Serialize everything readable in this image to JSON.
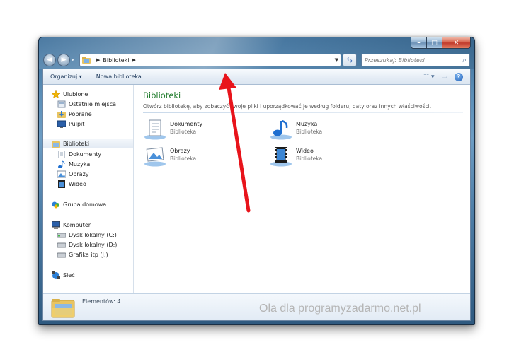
{
  "window": {
    "caption_buttons": {
      "minimize": "–",
      "maximize": "□",
      "close": "✕"
    }
  },
  "nav": {
    "back_glyph": "◀",
    "forward_glyph": "▶",
    "address": {
      "path_label": "Biblioteki"
    },
    "search_placeholder": "Przeszukaj: Biblioteki"
  },
  "toolbar": {
    "organize_label": "Organizuj ▾",
    "new_library_label": "Nowa biblioteka"
  },
  "sidebar": {
    "items": [
      {
        "label": "Ulubione",
        "icon": "star-icon"
      },
      {
        "label": "Ostatnie miejsca",
        "icon": "recent-places-icon"
      },
      {
        "label": "Pobrane",
        "icon": "downloads-icon"
      },
      {
        "label": "Pulpit",
        "icon": "desktop-icon"
      },
      {
        "label": "Biblioteki",
        "icon": "libraries-icon"
      },
      {
        "label": "Dokumenty",
        "icon": "documents-icon"
      },
      {
        "label": "Muzyka",
        "icon": "music-icon"
      },
      {
        "label": "Obrazy",
        "icon": "pictures-icon"
      },
      {
        "label": "Wideo",
        "icon": "video-icon"
      },
      {
        "label": "Grupa domowa",
        "icon": "homegroup-icon"
      },
      {
        "label": "Komputer",
        "icon": "computer-icon"
      },
      {
        "label": "Dysk lokalny (C:)",
        "icon": "drive-icon"
      },
      {
        "label": "Dysk lokalny (D:)",
        "icon": "drive-icon"
      },
      {
        "label": "Grafika itp (J:)",
        "icon": "drive-icon"
      },
      {
        "label": "Sieć",
        "icon": "network-icon"
      }
    ]
  },
  "content": {
    "title": "Biblioteki",
    "description": "Otwórz bibliotekę, aby zobaczyć swoje pliki i uporządkować je według folderu, daty oraz innych właściwości.",
    "libraries": [
      {
        "name": "Dokumenty",
        "type": "Biblioteka",
        "icon": "documents-library-icon"
      },
      {
        "name": "Muzyka",
        "type": "Biblioteka",
        "icon": "music-library-icon"
      },
      {
        "name": "Obrazy",
        "type": "Biblioteka",
        "icon": "pictures-library-icon"
      },
      {
        "name": "Wideo",
        "type": "Biblioteka",
        "icon": "video-library-icon"
      }
    ]
  },
  "details": {
    "count_text": "Elementów: 4"
  },
  "watermark": "Ola dla programyzadarmo.net.pl",
  "colors": {
    "title_green": "#1e7a2a",
    "arrow_red": "#e8141b"
  }
}
